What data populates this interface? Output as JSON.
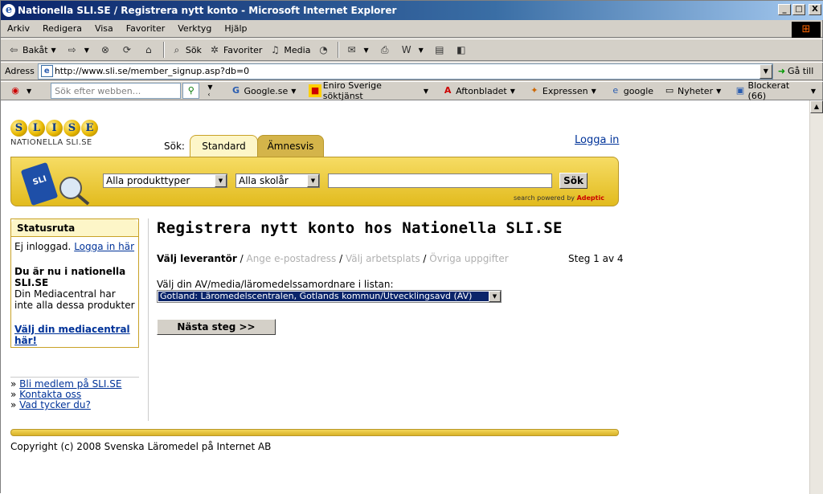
{
  "window": {
    "title": "Nationella SLI.SE / Registrera nytt konto - Microsoft Internet Explorer",
    "min": "_",
    "max": "□",
    "close": "X",
    "brand": "⊞"
  },
  "menu": [
    "Arkiv",
    "Redigera",
    "Visa",
    "Favoriter",
    "Verktyg",
    "Hjälp"
  ],
  "toolbar": {
    "back": "Bakåt",
    "search": "Sök",
    "favorites": "Favoriter",
    "media": "Media"
  },
  "address": {
    "label": "Adress",
    "url": "http://www.sli.se/member_signup.asp?db=0",
    "go": "Gå till"
  },
  "links": {
    "search_placeholder": "Sök efter webben...",
    "items": [
      "Google.se",
      "Eniro Sverige söktjänst",
      "Aftonbladet",
      "Expressen",
      "google",
      "Nyheter",
      "Blockerat (66)"
    ]
  },
  "site": {
    "logo_letters": [
      "S",
      "L",
      "I",
      "S",
      "E"
    ],
    "logo_sub": "NATIONELLA SLI.SE",
    "sok_label": "Sök:",
    "tabs": [
      "Standard",
      "Ämnesvis"
    ],
    "login": "Logga in",
    "product_type": "Alla produkttyper",
    "school_year": "Alla skolår",
    "search_button": "Sök",
    "powered_prefix": "search powered by",
    "powered_brand": "Adeptic"
  },
  "sidebar": {
    "title": "Statusruta",
    "not_logged_in": "Ej inloggad.",
    "login_here": "Logga in här",
    "current_title": "Du är nu i nationella SLI.SE",
    "current_text": "Din Mediacentral har inte alla dessa produkter",
    "choose_media": "Välj din mediacentral här!",
    "links": [
      "Bli medlem på SLI.SE",
      "Kontakta oss",
      "Vad tycker du?"
    ]
  },
  "main": {
    "heading": "Registrera nytt konto hos Nationella SLI.SE",
    "steps": [
      "Välj leverantör",
      "Ange e-postadress",
      "Välj arbetsplats",
      "Övriga uppgifter"
    ],
    "step_count": "Steg 1 av 4",
    "prompt": "Välj din AV/media/läromedelssamordnare i listan:",
    "provider": "Gotland: Läromedelscentralen, Gotlands kommun/Utvecklingsavd (AV)",
    "next": "Nästa steg >>"
  },
  "footer": {
    "copyright": "Copyright (c) 2008 Svenska Läromedel på Internet AB"
  }
}
